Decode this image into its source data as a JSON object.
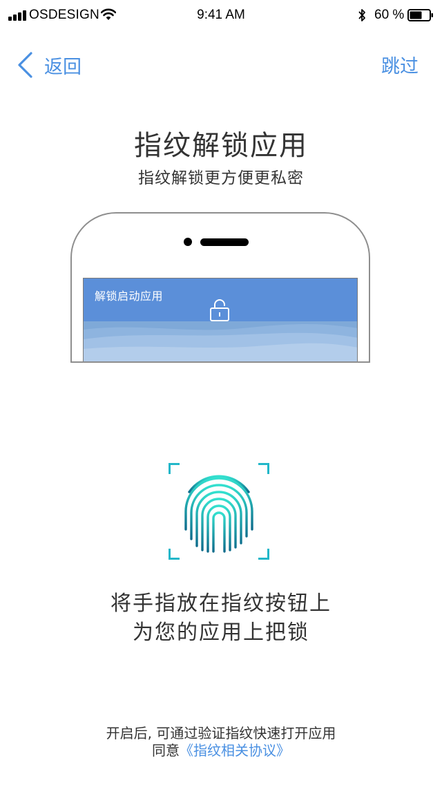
{
  "status_bar": {
    "carrier": "OSDESIGN",
    "time": "9:41 AM",
    "battery": "60 %",
    "icons": [
      "signal-icon",
      "wifi-icon",
      "bluetooth-icon",
      "battery-icon"
    ]
  },
  "nav": {
    "back_label": "返回",
    "skip_label": "跳过",
    "accent_color": "#4a90e2"
  },
  "header": {
    "title": "指纹解锁应用",
    "subtitle": "指纹解锁更方便更私密"
  },
  "illustration": {
    "screen_label": "解锁启动应用",
    "screen_color": "#5b8fd9",
    "icons": [
      "lock-icon"
    ]
  },
  "fingerprint": {
    "icon": "fingerprint-icon",
    "colors": [
      "#34e0cf",
      "#0e6c8c"
    ]
  },
  "instructions": {
    "line1": "将手指放在指纹按钮上",
    "line2": "为您的应用上把锁"
  },
  "footer": {
    "note": "开启后, 可通过验证指纹快速打开应用",
    "agree_prefix": "同意",
    "agreement_link": "《指纹相关协议》"
  }
}
